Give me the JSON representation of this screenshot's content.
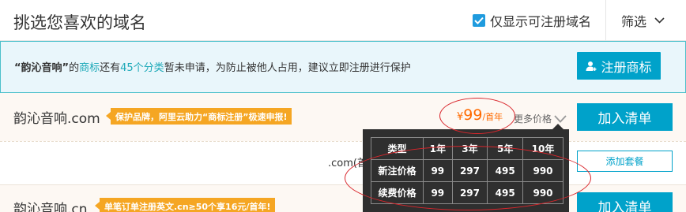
{
  "header": {
    "title": "挑选您喜欢的域名",
    "filter_checkbox_label": "仅显示可注册域名",
    "sort_label": "筛选"
  },
  "notice": {
    "quoted_name": "“韵沁音响”",
    "t1": "的",
    "link1": "商标",
    "t2": "还有",
    "link2": "45个分类",
    "t3": "暂未申请，为防止被他人占用，建议立即注册进行保护",
    "register_button_label": "注册商标"
  },
  "results": [
    {
      "domain": "韵沁音响.com",
      "promo": "保护品牌，阿里云助力“商标注册”极速申报!",
      "price_currency": "¥",
      "price_amount": "99",
      "price_unit": "/首年",
      "more_price_label": "更多价格",
      "add_button_label": "加入清单"
    },
    {
      "domain_fragment": ".com(首",
      "add_package_label": "添加套餐"
    },
    {
      "domain": "韵沁音响.cn",
      "promo": "单笔订单注册英文.cn≥50个享16元/首年!",
      "add_button_label": "加入清单"
    }
  ],
  "price_table": {
    "headers": [
      "类型",
      "1年",
      "3年",
      "5年",
      "10年"
    ],
    "rows": [
      [
        "新注价格",
        "99",
        "297",
        "495",
        "990"
      ],
      [
        "续费价格",
        "99",
        "297",
        "495",
        "990"
      ]
    ]
  },
  "colors": {
    "accent": "#00a2ca",
    "price": "#ff6a00",
    "promo": "#f5a623",
    "annotation": "#d9262c",
    "notice_bg": "#e9f6fb",
    "popup_bg": "#2f2f2f"
  },
  "icons": {
    "checkbox": "checkmark-icon",
    "sort": "chevron-down-icon",
    "register": "user-plus-icon",
    "more_price": "chevron-down-icon"
  }
}
